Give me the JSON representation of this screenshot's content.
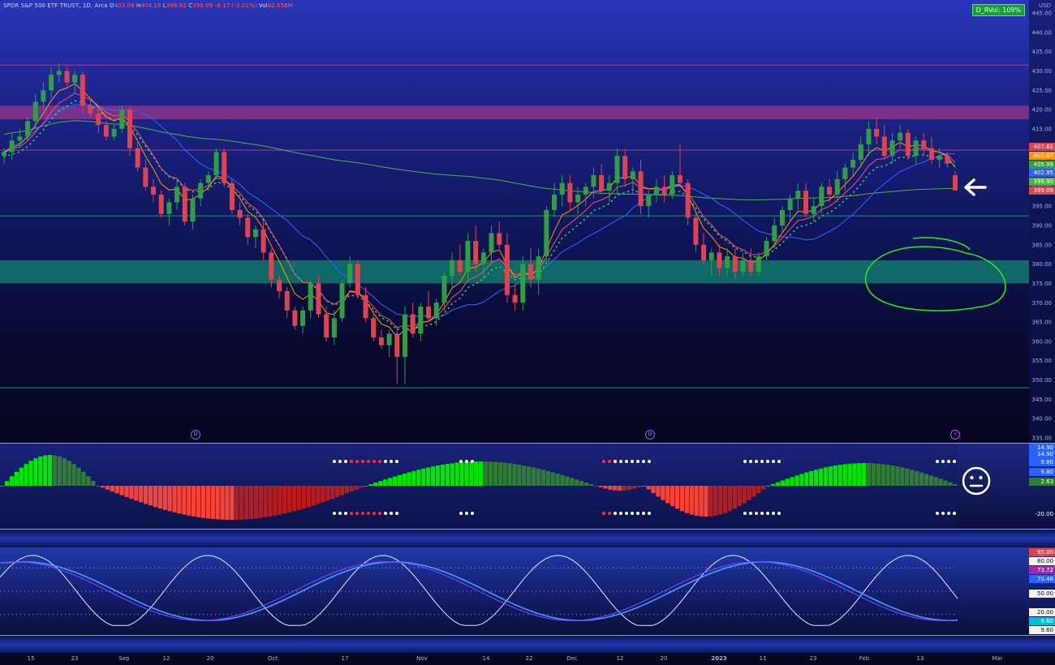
{
  "legend": {
    "symbol": "SPDR S&P 500 ETF TRUST, 1D, Arca",
    "open_label": "O",
    "open": "403.06",
    "high_label": "H",
    "high": "404.16",
    "low_label": "L",
    "low": "398.82",
    "close_label": "C",
    "close": "399.09",
    "change": "-8.17 (-2.01%)",
    "vol_label": "Vol",
    "vol": "82.656M"
  },
  "rvol_badge": "D_RVol: 109%",
  "currency": "USD",
  "colors": {
    "up_candle": "#2ea043",
    "down_candle": "#e0434f",
    "sma_green": "#4caf50",
    "ema_blue": "#2962ff",
    "ema_red": "#ff4d6d",
    "ema_orange": "#ff9800",
    "resistance_zone": "#c2408a",
    "support_zone": "#12a37a",
    "osc_bright_green": "#00e600",
    "osc_dark_green": "#2e7d32",
    "osc_red": "#f44336",
    "stoch_k": "#7b3cff",
    "stoch_d": "#3fa0ff",
    "stoch_rsi": "#e8eaff",
    "circle_annotation": "#22e622"
  },
  "price_axis": {
    "ticks": [
      "445.00",
      "440.00",
      "435.00",
      "430.00",
      "425.00",
      "420.00",
      "415.00",
      "410.00",
      "405.00",
      "400.00",
      "395.00",
      "390.00",
      "385.00",
      "380.00",
      "375.00",
      "370.00",
      "365.00",
      "360.00",
      "355.00",
      "350.00",
      "345.00",
      "340.00",
      "335.00"
    ]
  },
  "price_tags": [
    {
      "value": "407.61",
      "color": "#e0434f"
    },
    {
      "value": "407.47",
      "color": "#ff9800"
    },
    {
      "value": "405.99",
      "color": "#2ea043"
    },
    {
      "value": "402.95",
      "color": "#2962ff"
    },
    {
      "value": "399.90",
      "color": "#4caf50"
    },
    {
      "value": "399.09",
      "color": "#e0434f"
    }
  ],
  "oscillator": {
    "axis_labels": [
      "14.90",
      "14.90",
      "9.80",
      "9.80",
      "2.63",
      "-20.00"
    ],
    "tag_colors": [
      "#2962ff",
      "#2962ff",
      "#2962ff",
      "#2962ff",
      "#2e7d32",
      "transparent"
    ]
  },
  "stochastic": {
    "axis_labels": [
      "95.00",
      "80.00",
      "73.72",
      "70.48",
      "50.00",
      "20.00",
      "9.60",
      "9.60"
    ],
    "tag_colors": [
      "#e0434f",
      "transparent",
      "#9c27b0",
      "#2962ff",
      "transparent",
      "transparent",
      "#00bcd4",
      "transparent"
    ]
  },
  "time_axis": [
    "15",
    "23",
    "Sep",
    "12",
    "20",
    "Oct",
    "17",
    "Nov",
    "14",
    "22",
    "Dec",
    "12",
    "20",
    "2023",
    "11",
    "23",
    "Feb",
    "13",
    "Mar"
  ],
  "event_markers": [
    "D",
    "D",
    "⚡"
  ],
  "chart_data": {
    "type": "candlestick",
    "title": "SPDR S&P 500 ETF TRUST, 1D, Arca",
    "ylim": [
      335,
      445
    ],
    "zones": [
      {
        "name": "resistance",
        "range": [
          417.5,
          421
        ]
      },
      {
        "name": "support",
        "range": [
          375,
          381
        ]
      }
    ],
    "horizontal_lines": [
      431.5,
      409.5,
      392.5,
      348
    ],
    "candles": [
      [
        408,
        410,
        406,
        409
      ],
      [
        409,
        414,
        407,
        412
      ],
      [
        412,
        415,
        410,
        413
      ],
      [
        413,
        418,
        412,
        417
      ],
      [
        417,
        424,
        415,
        422
      ],
      [
        422,
        427,
        420,
        425
      ],
      [
        425,
        431,
        423,
        429
      ],
      [
        429,
        432,
        427,
        430
      ],
      [
        430,
        431,
        426,
        427
      ],
      [
        427,
        430,
        424,
        429
      ],
      [
        429,
        430,
        419,
        421
      ],
      [
        421,
        423,
        418,
        419
      ],
      [
        419,
        420,
        414,
        416
      ],
      [
        416,
        417,
        412,
        413
      ],
      [
        413,
        416,
        412,
        415
      ],
      [
        415,
        421,
        414,
        420
      ],
      [
        420,
        421,
        408,
        410
      ],
      [
        410,
        412,
        404,
        405
      ],
      [
        405,
        407,
        399,
        400
      ],
      [
        400,
        402,
        396,
        398
      ],
      [
        398,
        399,
        392,
        393
      ],
      [
        393,
        397,
        390,
        396
      ],
      [
        396,
        402,
        394,
        400
      ],
      [
        400,
        401,
        390,
        391
      ],
      [
        391,
        398,
        389,
        397
      ],
      [
        397,
        402,
        395,
        401
      ],
      [
        401,
        404,
        399,
        403
      ],
      [
        403,
        410,
        402,
        409
      ],
      [
        409,
        410,
        400,
        401
      ],
      [
        401,
        402,
        393,
        394
      ],
      [
        394,
        396,
        390,
        392
      ],
      [
        392,
        393,
        385,
        387
      ],
      [
        387,
        390,
        384,
        389
      ],
      [
        389,
        391,
        381,
        383
      ],
      [
        383,
        384,
        374,
        376
      ],
      [
        376,
        377,
        371,
        373
      ],
      [
        373,
        374,
        366,
        368
      ],
      [
        368,
        369,
        363,
        364
      ],
      [
        364,
        369,
        362,
        368
      ],
      [
        368,
        376,
        366,
        375
      ],
      [
        375,
        377,
        366,
        367
      ],
      [
        367,
        369,
        360,
        361
      ],
      [
        361,
        368,
        359,
        366
      ],
      [
        366,
        376,
        365,
        375
      ],
      [
        375,
        382,
        374,
        380
      ],
      [
        380,
        381,
        371,
        372
      ],
      [
        372,
        374,
        365,
        366
      ],
      [
        366,
        368,
        360,
        361
      ],
      [
        361,
        363,
        358,
        359
      ],
      [
        359,
        363,
        356,
        362
      ],
      [
        362,
        364,
        349,
        356
      ],
      [
        356,
        369,
        349,
        367
      ],
      [
        367,
        370,
        361,
        362
      ],
      [
        362,
        370,
        360,
        369
      ],
      [
        369,
        373,
        365,
        366
      ],
      [
        366,
        371,
        364,
        370
      ],
      [
        370,
        378,
        368,
        377
      ],
      [
        377,
        383,
        374,
        381
      ],
      [
        381,
        385,
        377,
        378
      ],
      [
        378,
        388,
        376,
        386
      ],
      [
        386,
        390,
        378,
        380
      ],
      [
        380,
        384,
        376,
        383
      ],
      [
        383,
        390,
        380,
        388
      ],
      [
        388,
        391,
        384,
        385
      ],
      [
        385,
        388,
        370,
        372
      ],
      [
        372,
        375,
        368,
        370
      ],
      [
        370,
        382,
        368,
        380
      ],
      [
        380,
        384,
        374,
        376
      ],
      [
        376,
        384,
        372,
        382
      ],
      [
        382,
        395,
        380,
        394
      ],
      [
        394,
        401,
        392,
        398
      ],
      [
        398,
        403,
        395,
        401
      ],
      [
        401,
        403,
        394,
        396
      ],
      [
        396,
        400,
        393,
        398
      ],
      [
        398,
        401,
        395,
        400
      ],
      [
        400,
        405,
        397,
        403
      ],
      [
        403,
        406,
        398,
        399
      ],
      [
        399,
        403,
        396,
        401
      ],
      [
        401,
        410,
        398,
        408
      ],
      [
        408,
        410,
        400,
        402
      ],
      [
        402,
        405,
        398,
        404
      ],
      [
        404,
        407,
        393,
        395
      ],
      [
        395,
        399,
        392,
        398
      ],
      [
        398,
        402,
        396,
        400
      ],
      [
        400,
        403,
        396,
        398
      ],
      [
        398,
        404,
        397,
        403
      ],
      [
        403,
        411,
        400,
        401
      ],
      [
        401,
        402,
        390,
        392
      ],
      [
        392,
        393,
        383,
        385
      ],
      [
        385,
        388,
        380,
        381
      ],
      [
        381,
        384,
        377,
        383
      ],
      [
        383,
        385,
        377,
        379
      ],
      [
        379,
        384,
        377,
        382
      ],
      [
        382,
        384,
        376,
        378
      ],
      [
        378,
        383,
        377,
        381
      ],
      [
        381,
        384,
        377,
        378
      ],
      [
        378,
        383,
        377,
        382
      ],
      [
        382,
        387,
        381,
        386
      ],
      [
        386,
        392,
        384,
        390
      ],
      [
        390,
        395,
        388,
        394
      ],
      [
        394,
        398,
        391,
        397
      ],
      [
        397,
        401,
        394,
        399
      ],
      [
        399,
        401,
        392,
        393
      ],
      [
        393,
        397,
        391,
        395
      ],
      [
        395,
        401,
        393,
        400
      ],
      [
        400,
        402,
        396,
        398
      ],
      [
        398,
        404,
        396,
        402
      ],
      [
        402,
        406,
        399,
        405
      ],
      [
        405,
        409,
        403,
        407
      ],
      [
        407,
        413,
        405,
        411
      ],
      [
        411,
        417,
        408,
        415
      ],
      [
        415,
        418,
        411,
        413
      ],
      [
        413,
        416,
        407,
        408
      ],
      [
        408,
        414,
        406,
        412
      ],
      [
        412,
        416,
        410,
        414
      ],
      [
        414,
        415,
        407,
        408
      ],
      [
        408,
        413,
        406,
        412
      ],
      [
        412,
        414,
        408,
        410
      ],
      [
        410,
        413,
        406,
        407
      ],
      [
        407,
        410,
        405,
        408
      ],
      [
        408,
        409,
        405,
        406
      ],
      [
        403,
        404,
        399,
        399.09
      ]
    ],
    "sma_200_approx": 399.9,
    "stoch_last": {
      "k": 73.72,
      "d": 70.48
    }
  }
}
